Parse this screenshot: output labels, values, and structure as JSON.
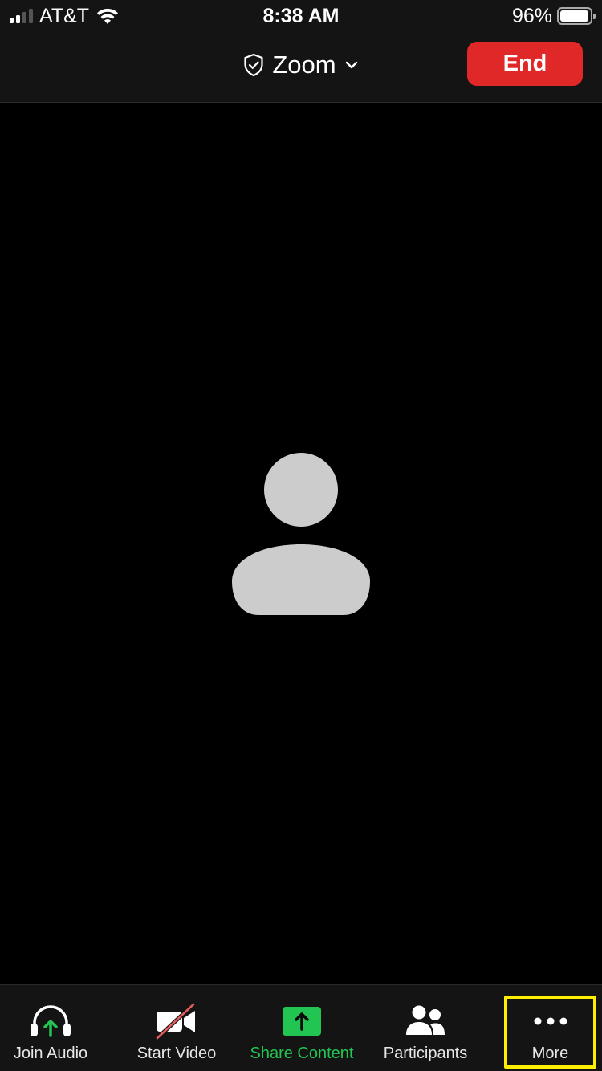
{
  "status_bar": {
    "carrier": "AT&T",
    "time": "8:38 AM",
    "battery_percent": "96%",
    "signal_bars_active": 2,
    "signal_bars_total": 4
  },
  "header": {
    "meeting_title": "Zoom",
    "end_label": "End",
    "end_color": "#e02828"
  },
  "video": {
    "placeholder": "person-silhouette"
  },
  "toolbar": {
    "items": [
      {
        "label": "Join Audio",
        "icon": "headphones-icon"
      },
      {
        "label": "Start Video",
        "icon": "video-off-icon"
      },
      {
        "label": "Share Content",
        "icon": "share-screen-icon",
        "color": "#23c552"
      },
      {
        "label": "Participants",
        "icon": "participants-icon"
      },
      {
        "label": "More",
        "icon": "more-dots-icon",
        "highlighted": true
      }
    ]
  },
  "highlight_color": "#ffef00"
}
